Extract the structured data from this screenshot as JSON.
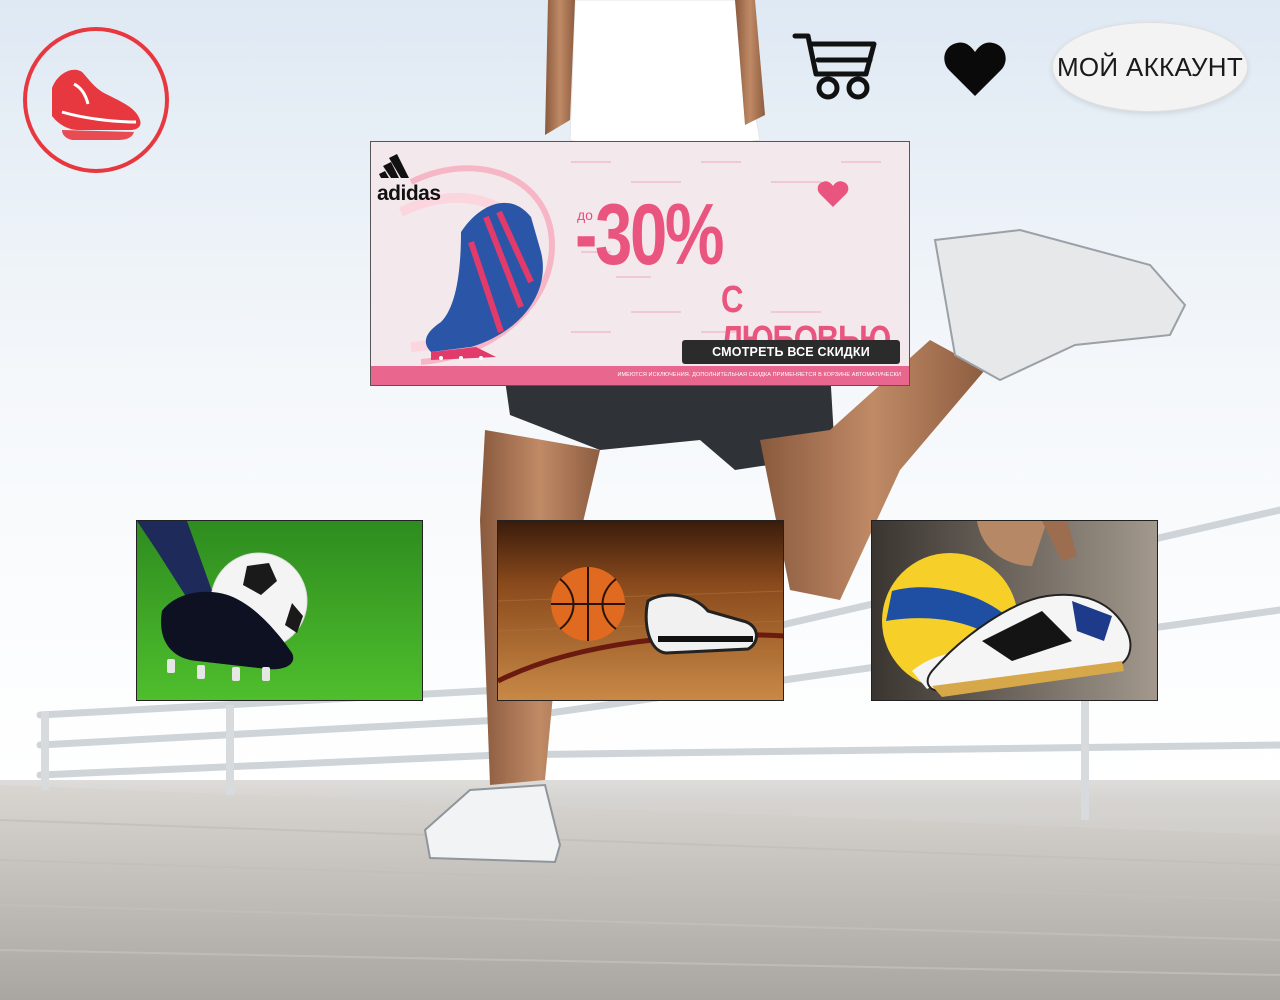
{
  "header": {
    "logo_icon": "running-shoe-icon",
    "cart_icon": "cart-icon",
    "favorites_icon": "heart-icon",
    "account_label": "МОЙ АККАУНТ"
  },
  "promo": {
    "brand": "adidas",
    "prefix": "до",
    "discount": "-30%",
    "tagline": "С ЛЮБОВЬЮ",
    "cta_label": "СМОТРЕТЬ ВСЕ СКИДКИ",
    "disclaimer": "ИМЕЮТСЯ ИСКЛЮЧЕНИЯ. ДОПОЛНИТЕЛЬНАЯ СКИДКА ПРИМЕНЯЕТСЯ В КОРЗИНЕ АВТОМАТИЧЕСКИ",
    "colors": {
      "accent": "#e9557f",
      "strip": "#e9678f",
      "button": "#2b2b2b"
    }
  },
  "categories": [
    {
      "icon": "football-icon"
    },
    {
      "icon": "basketball-icon"
    },
    {
      "icon": "volleyball-icon"
    }
  ],
  "colors": {
    "logo": "#e8383f"
  }
}
